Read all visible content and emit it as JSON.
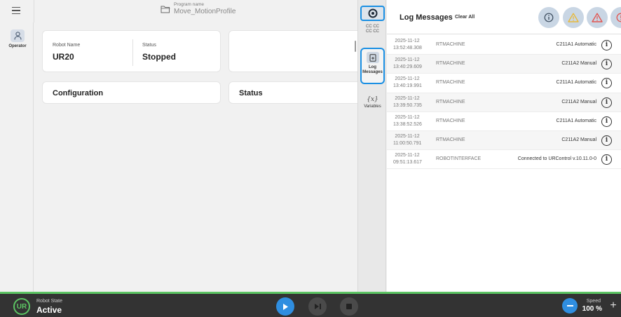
{
  "topbar": {
    "menu_icon": "hamburger-icon",
    "program_label": "Program name",
    "program_name": "Move_MotionProfile",
    "folder_icon": "folder-icon"
  },
  "leftrail": {
    "operator_label": "Operator",
    "operator_icon": "person-icon"
  },
  "main": {
    "robot_name_label": "Robot Name",
    "robot_name": "UR20",
    "status_label": "Status",
    "status_value": "Stopped",
    "configuration_title": "Configuration",
    "status_card_title": "Status"
  },
  "sidetools": {
    "ur_icon": "ur-logo-icon",
    "cc_line1": "CC CC",
    "cc_line2": "CC CC",
    "log_label_line1": "Log",
    "log_label_line2": "Messages",
    "log_icon": "document-icon",
    "variables_icon": "{x}",
    "variables_label": "Variables"
  },
  "log": {
    "title": "Log Messages",
    "clear_all": "Clear All",
    "filters": [
      {
        "name": "info-filter",
        "icon": "info-icon",
        "color": "#c9d6e4"
      },
      {
        "name": "warning-filter",
        "icon": "warning-icon",
        "color": "#e8b93a"
      },
      {
        "name": "error-filter",
        "icon": "error-icon",
        "color": "#e2544f"
      },
      {
        "name": "critical-filter",
        "icon": "critical-icon",
        "color": "#e2544f"
      }
    ],
    "rows": [
      {
        "date": "2025-11-12",
        "time": "13:52:48.308",
        "source": "RTMACHINE",
        "message": "C211A1 Automatic"
      },
      {
        "date": "2025-11-12",
        "time": "13:40:29.609",
        "source": "RTMACHINE",
        "message": "C211A2 Manual"
      },
      {
        "date": "2025-11-12",
        "time": "13:40:19.991",
        "source": "RTMACHINE",
        "message": "C211A1 Automatic"
      },
      {
        "date": "2025-11-12",
        "time": "13:39:50.735",
        "source": "RTMACHINE",
        "message": "C211A2 Manual"
      },
      {
        "date": "2025-11-12",
        "time": "13:38:52.526",
        "source": "RTMACHINE",
        "message": "C211A1 Automatic"
      },
      {
        "date": "2025-11-12",
        "time": "11:00:50.791",
        "source": "RTMACHINE",
        "message": "C211A2 Manual"
      },
      {
        "date": "2025-11-12",
        "time": "09:51:13.617",
        "source": "ROBOTINTERFACE",
        "message": "Connected to URControl v.10.11.0-0"
      }
    ]
  },
  "bottombar": {
    "robot_state_label": "Robot State",
    "robot_state_value": "Active",
    "state_icon_text": "UR",
    "speed_label": "Speed",
    "speed_value": "100 %",
    "accent": "#5cc463",
    "play_color": "#2f8ee0"
  }
}
